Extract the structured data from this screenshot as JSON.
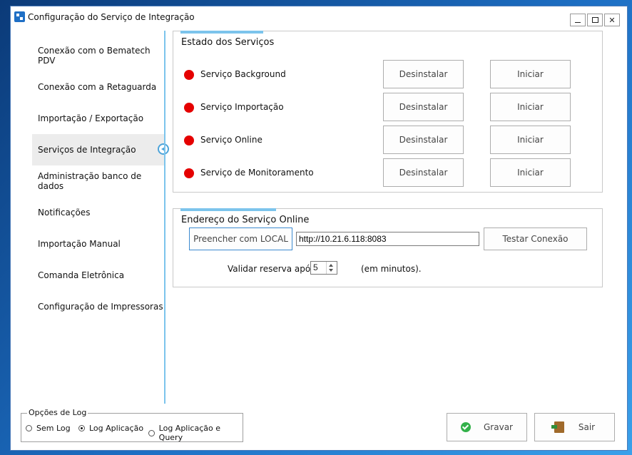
{
  "window": {
    "title": "Configuração do Serviço de Integração"
  },
  "sidebar": {
    "items": [
      {
        "label": "Conexão com o Bematech PDV"
      },
      {
        "label": "Conexão com a Retaguarda"
      },
      {
        "label": "Importação / Exportação"
      },
      {
        "label": "Serviços de Integração",
        "active": true
      },
      {
        "label": "Administração banco de dados"
      },
      {
        "label": "Notificações"
      },
      {
        "label": "Importação Manual"
      },
      {
        "label": "Comanda Eletrônica"
      },
      {
        "label": "Configuração de Impressoras"
      }
    ]
  },
  "services": {
    "title": "Estado dos Serviços",
    "status_color": "#e50000",
    "rows": [
      {
        "name": "Serviço Background",
        "uninstall": "Desinstalar",
        "start": "Iniciar"
      },
      {
        "name": "Serviço Importação",
        "uninstall": "Desinstalar",
        "start": "Iniciar"
      },
      {
        "name": "Serviço Online",
        "uninstall": "Desinstalar",
        "start": "Iniciar"
      },
      {
        "name": "Serviço de Monitoramento",
        "uninstall": "Desinstalar",
        "start": "Iniciar"
      }
    ]
  },
  "online": {
    "title": "Endereço do Serviço Online",
    "fill_local": "Preencher com LOCAL",
    "url": "http://10.21.6.118:8083",
    "test": "Testar Conexão",
    "reserve_label": "Validar reserva após:",
    "reserve_value": "5",
    "reserve_unit": "(em minutos)."
  },
  "log": {
    "title": "Opções de Log",
    "options": [
      {
        "label": "Sem Log",
        "selected": false
      },
      {
        "label": "Log Aplicação",
        "selected": true
      },
      {
        "label": "Log Aplicação e Query",
        "selected": false
      }
    ]
  },
  "actions": {
    "save": "Gravar",
    "exit": "Sair"
  }
}
